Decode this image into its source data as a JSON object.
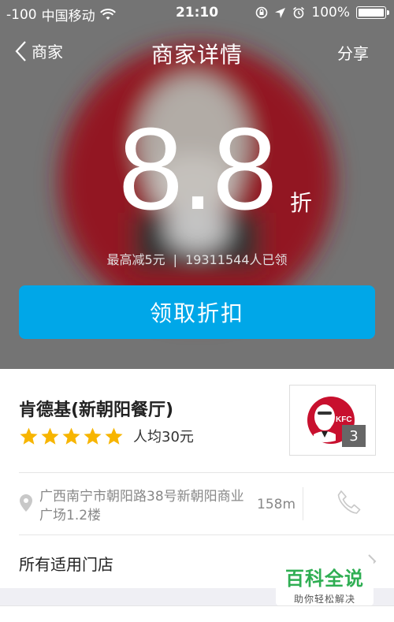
{
  "status_bar": {
    "signal": "-100",
    "carrier": "中国移动",
    "time": "21:10",
    "battery": "100%",
    "icons": [
      "wifi-icon",
      "rotation-lock-icon",
      "location-arrow-icon",
      "alarm-icon",
      "battery-icon"
    ]
  },
  "nav": {
    "back_label": "商家",
    "title": "商家详情",
    "share_label": "分享"
  },
  "offer": {
    "discount_value": "8.8",
    "discount_unit": "折",
    "max_reduction": "最高减5元",
    "separator": "|",
    "claimed_count": "19311544人已领",
    "claim_button": "领取折扣"
  },
  "merchant": {
    "name": "肯德基(新朝阳餐厅)",
    "rating": 5,
    "avg_price": "人均30元",
    "logo_text": "KFC",
    "photo_count": "3",
    "address": "广西南宁市朝阳路38号新朝阳商业广场1.2楼",
    "distance": "158m",
    "all_stores_label": "所有适用门店"
  },
  "watermark": {
    "main": "百科全说",
    "sub": "助你轻松解决"
  },
  "colors": {
    "accent_blue": "#00a7e8",
    "star_yellow": "#f7b500",
    "kfc_red": "#c8102e",
    "watermark_green": "#2fae53"
  }
}
